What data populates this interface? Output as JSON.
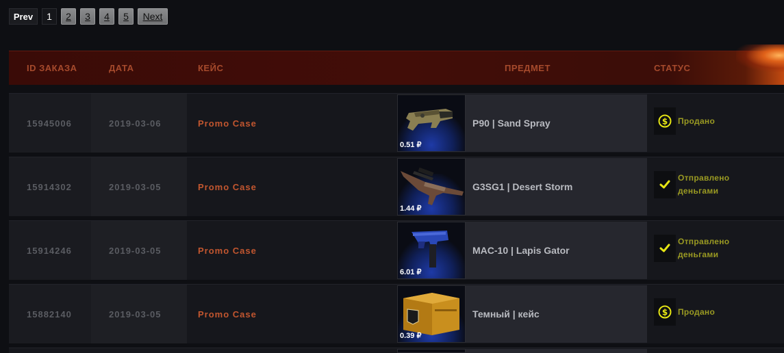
{
  "pagination": {
    "prev": "Prev",
    "current": "1",
    "pages": [
      "2",
      "3",
      "4",
      "5"
    ],
    "next": "Next"
  },
  "table": {
    "headers": {
      "id": "ID ЗАКАЗА",
      "date": "ДАТА",
      "case": "КЕЙС",
      "item": "ПРЕДМЕТ",
      "status": "СТАТУС"
    },
    "rows": [
      {
        "id": "15945006",
        "date": "2019-03-06",
        "case": "Promo Case",
        "price": "0.51 ₽",
        "item": "P90 | Sand Spray",
        "status": "Продано",
        "status_icon": "coin-icon",
        "item_icon": "p90-smg-icon"
      },
      {
        "id": "15914302",
        "date": "2019-03-05",
        "case": "Promo Case",
        "price": "1.44 ₽",
        "item": "G3SG1 | Desert Storm",
        "status": "Отправлено деньгами",
        "status_icon": "check-icon",
        "item_icon": "g3sg1-rifle-icon"
      },
      {
        "id": "15914246",
        "date": "2019-03-05",
        "case": "Promo Case",
        "price": "6.01 ₽",
        "item": "MAC-10 | Lapis Gator",
        "status": "Отправлено деньгами",
        "status_icon": "check-icon",
        "item_icon": "mac10-smg-icon"
      },
      {
        "id": "15882140",
        "date": "2019-03-05",
        "case": "Promo Case",
        "price": "0.39 ₽",
        "item": "Темный | кейс",
        "status": "Продано",
        "status_icon": "coin-icon",
        "item_icon": "case-box-icon"
      }
    ]
  },
  "colors": {
    "header_text": "#a64a2c",
    "case_text": "#c2562f",
    "status_text": "#9a9a22",
    "status_icon": "#e6e614"
  }
}
